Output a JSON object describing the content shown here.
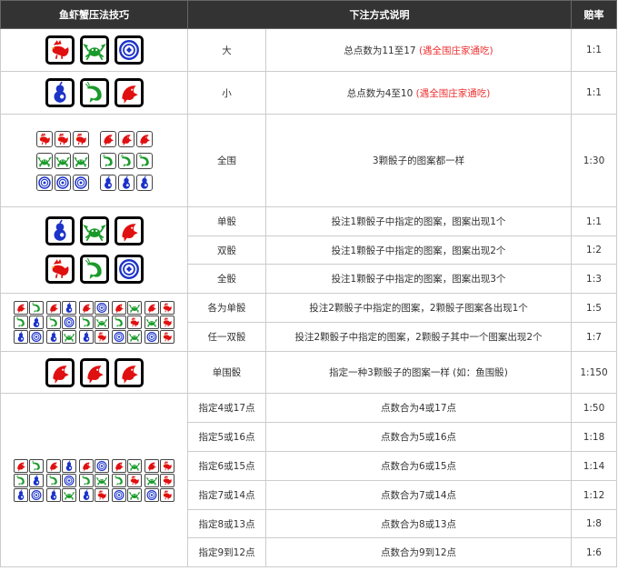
{
  "headers": [
    "鱼虾蟹压法技巧",
    "下注方式说明",
    "赔率"
  ],
  "rows": {
    "big": {
      "name": "大",
      "desc": "总点数为11至17",
      "note": "(遇全围庄家通吃)",
      "odds": "1:1"
    },
    "small": {
      "name": "小",
      "desc": "总点数为4至10",
      "note": "(遇全围庄家通吃)",
      "odds": "1:1"
    },
    "triple_any": {
      "name": "全围",
      "desc": "3颗骰子的图案都一样",
      "odds": "1:30"
    },
    "single": {
      "name": "单骰",
      "desc": "投注1颗骰子中指定的图案，图案出现1个",
      "odds": "1:1"
    },
    "double": {
      "name": "双骰",
      "desc": "投注1颗骰子中指定的图案，图案出现2个",
      "odds": "1:2"
    },
    "triple": {
      "name": "全骰",
      "desc": "投注1颗骰子中指定的图案，图案出现3个",
      "odds": "1:3"
    },
    "each_single": {
      "name": "各为单骰",
      "desc": "投注2颗骰子中指定的图案，2颗骰子图案各出现1个",
      "odds": "1:5"
    },
    "any_double": {
      "name": "任一双骰",
      "desc": "投注2颗骰子中指定的图案，2颗骰子其中一个图案出现2个",
      "odds": "1:7"
    },
    "specific_triple": {
      "name": "单围骰",
      "desc": "指定一种3颗骰子的图案一样 (如：鱼围骰)",
      "odds": "1:150"
    },
    "points": [
      {
        "name": "指定4或17点",
        "desc": "点数合为4或17点",
        "odds": "1:50"
      },
      {
        "name": "指定5或16点",
        "desc": "点数合为5或16点",
        "odds": "1:18"
      },
      {
        "name": "指定6或15点",
        "desc": "点数合为6或15点",
        "odds": "1:14"
      },
      {
        "name": "指定7或14点",
        "desc": "点数合为7或14点",
        "odds": "1:12"
      },
      {
        "name": "指定8或13点",
        "desc": "点数合为8或13点",
        "odds": "1:8"
      },
      {
        "name": "指定9到12点",
        "desc": "点数合为9到12点",
        "odds": "1:6"
      }
    ]
  },
  "icons": {
    "rooster": {
      "name": "rooster-icon",
      "color": "#e01010"
    },
    "crab": {
      "name": "crab-icon",
      "color": "#1a9a2a"
    },
    "coin": {
      "name": "coin-icon",
      "color": "#1c33c8"
    },
    "gourd": {
      "name": "gourd-icon",
      "color": "#1c33c8"
    },
    "shrimp": {
      "name": "shrimp-icon",
      "color": "#1a9a2a"
    },
    "fish": {
      "name": "fish-icon",
      "color": "#e01010"
    }
  },
  "tiles": {
    "big": [
      "rooster",
      "crab",
      "coin"
    ],
    "small": [
      "gourd",
      "shrimp",
      "fish"
    ],
    "triple_any": [
      [
        [
          "rooster",
          "rooster",
          "rooster"
        ],
        [
          "fish",
          "fish",
          "fish"
        ]
      ],
      [
        [
          "crab",
          "crab",
          "crab"
        ],
        [
          "shrimp",
          "shrimp",
          "shrimp"
        ]
      ],
      [
        [
          "coin",
          "coin",
          "coin"
        ],
        [
          "gourd",
          "gourd",
          "gourd"
        ]
      ]
    ],
    "singles": [
      [
        "gourd",
        "crab",
        "fish"
      ],
      [
        "rooster",
        "shrimp",
        "coin"
      ]
    ],
    "pairs": [
      [
        "fish",
        "shrimp",
        "fish",
        "gourd",
        "fish",
        "coin",
        "fish",
        "crab",
        "fish",
        "rooster"
      ],
      [
        "shrimp",
        "gourd",
        "shrimp",
        "coin",
        "shrimp",
        "crab",
        "shrimp",
        "rooster",
        "crab",
        "rooster"
      ],
      [
        "gourd",
        "coin",
        "gourd",
        "crab",
        "gourd",
        "rooster",
        "coin",
        "crab",
        "coin",
        "rooster"
      ]
    ],
    "specific_triple": [
      "fish",
      "fish",
      "fish"
    ],
    "points": [
      [
        "fish",
        "shrimp",
        "fish",
        "gourd",
        "fish",
        "coin",
        "fish",
        "crab",
        "fish",
        "rooster"
      ],
      [
        "shrimp",
        "gourd",
        "shrimp",
        "coin",
        "shrimp",
        "crab",
        "shrimp",
        "rooster",
        "crab",
        "rooster"
      ],
      [
        "gourd",
        "coin",
        "gourd",
        "crab",
        "gourd",
        "rooster",
        "coin",
        "crab",
        "coin",
        "rooster"
      ]
    ]
  }
}
